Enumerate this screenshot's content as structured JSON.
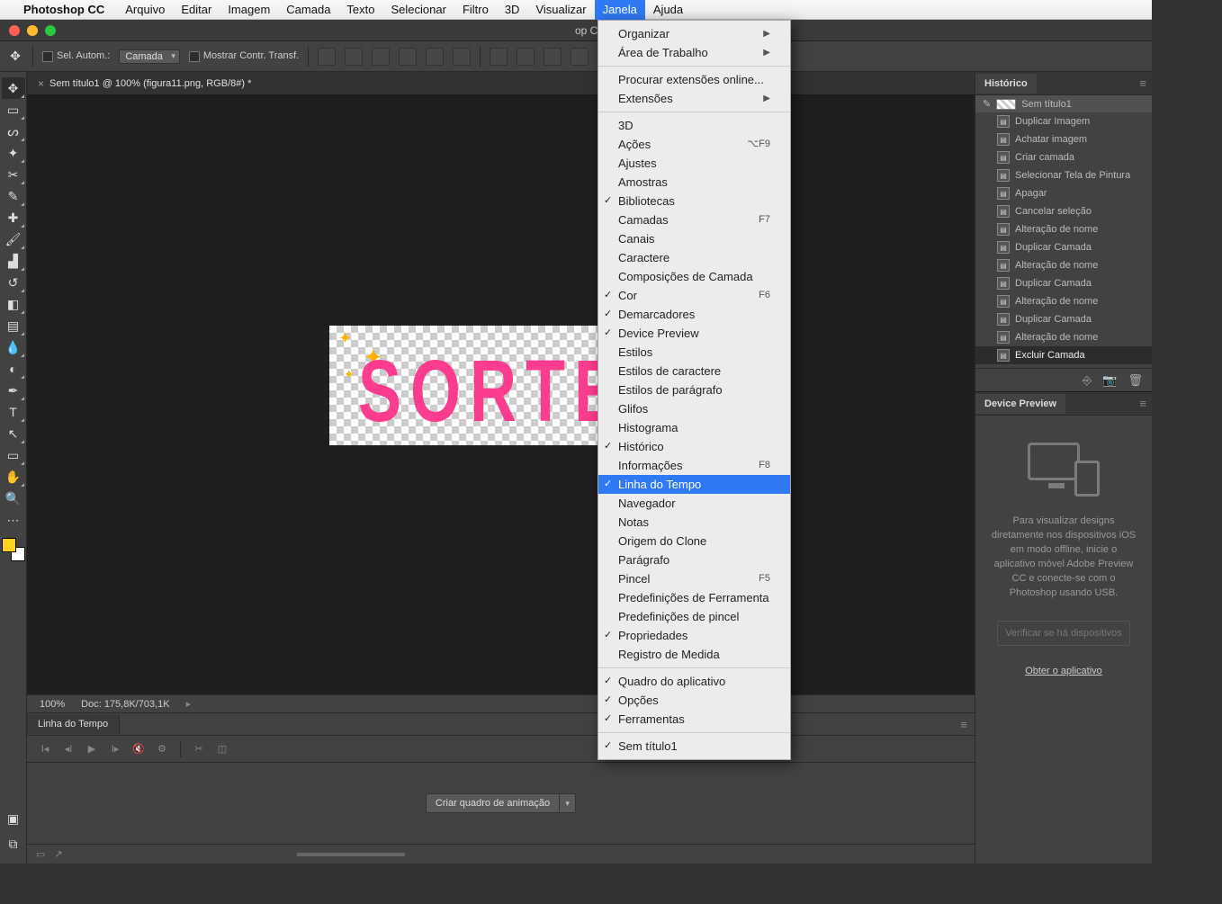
{
  "mac_menu": {
    "app_name": "Photoshop CC",
    "items": [
      "Arquivo",
      "Editar",
      "Imagem",
      "Camada",
      "Texto",
      "Selecionar",
      "Filtro",
      "3D",
      "Visualizar",
      "Janela",
      "Ajuda"
    ],
    "active_index": 9
  },
  "title_bar": {
    "title": "op CC 2017"
  },
  "options_bar": {
    "autoselect_label": "Sel. Autom.:",
    "autoselect_value": "Camada",
    "show_transform_label": "Mostrar Contr. Transf."
  },
  "document_tab": {
    "label": "Sem título1 @ 100% (figura11.png, RGB/8#) *"
  },
  "canvas": {
    "text": "SORTEIO!"
  },
  "status_bar": {
    "zoom": "100%",
    "doc": "Doc: 175,8K/703,1K"
  },
  "timeline": {
    "tab": "Linha do Tempo",
    "create_button": "Criar quadro de animação"
  },
  "history_panel": {
    "title": "Histórico",
    "root": "Sem título1",
    "items": [
      "Duplicar Imagem",
      "Achatar imagem",
      "Criar camada",
      "Selecionar Tela de Pintura",
      "Apagar",
      "Cancelar seleção",
      "Alteração de nome",
      "Duplicar Camada",
      "Alteração de nome",
      "Duplicar Camada",
      "Alteração de nome",
      "Duplicar Camada",
      "Alteração de nome",
      "Excluir Camada"
    ],
    "selected_index": 13
  },
  "device_preview": {
    "title": "Device Preview",
    "text": "Para visualizar designs diretamente nos dispositivos iOS em modo offline, inicie o aplicativo móvel Adobe Preview CC e conecte-se com o Photoshop usando USB.",
    "button": "Verificar se há dispositivos",
    "link": "Obter o aplicativo"
  },
  "dropdown": {
    "groups": [
      [
        {
          "label": "Organizar",
          "sub": true
        },
        {
          "label": "Área de Trabalho",
          "sub": true
        }
      ],
      [
        {
          "label": "Procurar extensões online..."
        },
        {
          "label": "Extensões",
          "sub": true
        }
      ],
      [
        {
          "label": "3D"
        },
        {
          "label": "Ações",
          "shortcut": "⌥F9"
        },
        {
          "label": "Ajustes"
        },
        {
          "label": "Amostras"
        },
        {
          "label": "Bibliotecas",
          "checked": true
        },
        {
          "label": "Camadas",
          "shortcut": "F7"
        },
        {
          "label": "Canais"
        },
        {
          "label": "Caractere"
        },
        {
          "label": "Composições de Camada"
        },
        {
          "label": "Cor",
          "checked": true,
          "shortcut": "F6"
        },
        {
          "label": "Demarcadores",
          "checked": true
        },
        {
          "label": "Device Preview",
          "checked": true
        },
        {
          "label": "Estilos"
        },
        {
          "label": "Estilos de caractere"
        },
        {
          "label": "Estilos de parágrafo"
        },
        {
          "label": "Glifos"
        },
        {
          "label": "Histograma"
        },
        {
          "label": "Histórico",
          "checked": true
        },
        {
          "label": "Informações",
          "shortcut": "F8"
        },
        {
          "label": "Linha do Tempo",
          "checked": true,
          "highlighted": true
        },
        {
          "label": "Navegador"
        },
        {
          "label": "Notas"
        },
        {
          "label": "Origem do Clone"
        },
        {
          "label": "Parágrafo"
        },
        {
          "label": "Pincel",
          "shortcut": "F5"
        },
        {
          "label": "Predefinições de Ferramenta"
        },
        {
          "label": "Predefinições de pincel"
        },
        {
          "label": "Propriedades",
          "checked": true
        },
        {
          "label": "Registro de Medida"
        }
      ],
      [
        {
          "label": "Quadro do aplicativo",
          "checked": true
        },
        {
          "label": "Opções",
          "checked": true
        },
        {
          "label": "Ferramentas",
          "checked": true
        }
      ],
      [
        {
          "label": "Sem título1",
          "checked": true
        }
      ]
    ]
  }
}
